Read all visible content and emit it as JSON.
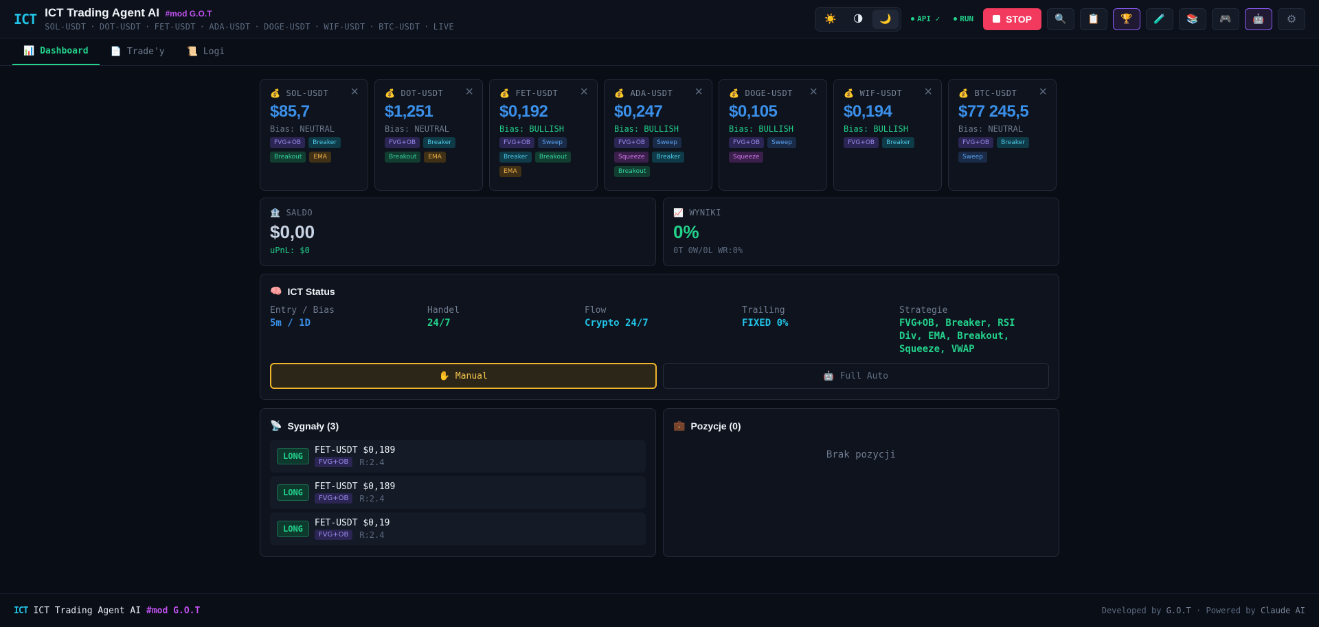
{
  "header": {
    "logo": "ICT",
    "title": "ICT Trading Agent AI",
    "mod": "#mod G.O.T",
    "pairs": [
      "SOL-USDT",
      "DOT-USDT",
      "FET-USDT",
      "ADA-USDT",
      "DOGE-USDT",
      "WIF-USDT",
      "BTC-USDT",
      "LIVE"
    ],
    "theme_icons": [
      "☀️",
      "🌗",
      "🌙"
    ],
    "api_label": "API ✓",
    "run_label": "RUN",
    "stop_label": "STOP",
    "tool_icons": [
      "🔍",
      "📋",
      "🏆",
      "🧪",
      "📚",
      "🎮",
      "🤖",
      "⚙"
    ]
  },
  "tabs": [
    {
      "icon": "📊",
      "label": "Dashboard"
    },
    {
      "icon": "📄",
      "label": "Trade'y"
    },
    {
      "icon": "📜",
      "label": "Logi"
    }
  ],
  "coins": [
    {
      "icon": "💰",
      "symbol": "SOL-USDT",
      "price": "$85,7",
      "bias": "Bias: NEUTRAL",
      "bias_type": "neutral",
      "tags": [
        {
          "label": "FVG+OB",
          "kind": "fvg"
        },
        {
          "label": "Breaker",
          "kind": "breaker"
        },
        {
          "label": "Breakout",
          "kind": "breakout"
        },
        {
          "label": "EMA",
          "kind": "ema"
        }
      ]
    },
    {
      "icon": "💰",
      "symbol": "DOT-USDT",
      "price": "$1,251",
      "bias": "Bias: NEUTRAL",
      "bias_type": "neutral",
      "tags": [
        {
          "label": "FVG+OB",
          "kind": "fvg"
        },
        {
          "label": "Breaker",
          "kind": "breaker"
        },
        {
          "label": "Breakout",
          "kind": "breakout"
        },
        {
          "label": "EMA",
          "kind": "ema"
        }
      ]
    },
    {
      "icon": "💰",
      "symbol": "FET-USDT",
      "price": "$0,192",
      "bias": "Bias: BULLISH",
      "bias_type": "bullish",
      "tags": [
        {
          "label": "FVG+OB",
          "kind": "fvg"
        },
        {
          "label": "Sweep",
          "kind": "sweep"
        },
        {
          "label": "Breaker",
          "kind": "breaker"
        },
        {
          "label": "Breakout",
          "kind": "breakout"
        },
        {
          "label": "EMA",
          "kind": "ema"
        }
      ]
    },
    {
      "icon": "💰",
      "symbol": "ADA-USDT",
      "price": "$0,247",
      "bias": "Bias: BULLISH",
      "bias_type": "bullish",
      "tags": [
        {
          "label": "FVG+OB",
          "kind": "fvg"
        },
        {
          "label": "Sweep",
          "kind": "sweep"
        },
        {
          "label": "Squeeze",
          "kind": "squeeze"
        },
        {
          "label": "Breaker",
          "kind": "breaker"
        },
        {
          "label": "Breakout",
          "kind": "breakout"
        }
      ]
    },
    {
      "icon": "💰",
      "symbol": "DOGE-USDT",
      "price": "$0,105",
      "bias": "Bias: BULLISH",
      "bias_type": "bullish",
      "tags": [
        {
          "label": "FVG+OB",
          "kind": "fvg"
        },
        {
          "label": "Sweep",
          "kind": "sweep"
        },
        {
          "label": "Squeeze",
          "kind": "squeeze"
        }
      ]
    },
    {
      "icon": "💰",
      "symbol": "WIF-USDT",
      "price": "$0,194",
      "bias": "Bias: BULLISH",
      "bias_type": "bullish",
      "tags": [
        {
          "label": "FVG+OB",
          "kind": "fvg"
        },
        {
          "label": "Breaker",
          "kind": "breaker"
        }
      ]
    },
    {
      "icon": "💰",
      "symbol": "BTC-USDT",
      "price": "$77 245,5",
      "bias": "Bias: NEUTRAL",
      "bias_type": "neutral",
      "tags": [
        {
          "label": "FVG+OB",
          "kind": "fvg"
        },
        {
          "label": "Breaker",
          "kind": "breaker"
        },
        {
          "label": "Sweep",
          "kind": "sweep"
        }
      ]
    }
  ],
  "saldo": {
    "icon": "🏦",
    "label": "SALDO",
    "value": "$0,00",
    "upnl": "uPnL: $0"
  },
  "wyniki": {
    "icon": "📈",
    "label": "WYNIKI",
    "value": "0%",
    "sub": "0T 0W/0L WR:0%"
  },
  "ict_status": {
    "icon": "🧠",
    "title": "ICT Status",
    "columns": [
      {
        "label": "Entry / Bias",
        "value": "5m / 1D",
        "color": "#3b8fe8"
      },
      {
        "label": "Handel",
        "value": "24/7",
        "color": "#23d18b"
      },
      {
        "label": "Flow",
        "value": "Crypto 24/7",
        "color": "#22c3e6"
      },
      {
        "label": "Trailing",
        "value": "FIXED 0%",
        "color": "#22c3e6"
      },
      {
        "label": "Strategie",
        "value": "FVG+OB, Breaker, RSI Div, EMA, Breakout, Squeeze, VWAP",
        "color": "#23d18b"
      }
    ],
    "manual": {
      "icon": "✋",
      "label": "Manual"
    },
    "auto": {
      "icon": "🤖",
      "label": "Full Auto"
    }
  },
  "signals": {
    "icon": "📡",
    "title": "Sygnały (3)",
    "items": [
      {
        "side": "LONG",
        "text": "FET-USDT $0,189",
        "tag": "FVG+OB",
        "rr": "R:2.4"
      },
      {
        "side": "LONG",
        "text": "FET-USDT $0,189",
        "tag": "FVG+OB",
        "rr": "R:2.4"
      },
      {
        "side": "LONG",
        "text": "FET-USDT $0,19",
        "tag": "FVG+OB",
        "rr": "R:2.4"
      }
    ]
  },
  "positions": {
    "icon": "💼",
    "title": "Pozycje (0)",
    "empty": "Brak pozycji"
  },
  "footer": {
    "logo": "ICT",
    "title": "ICT Trading Agent AI",
    "mod": "#mod G.O.T",
    "dev_prefix": "Developed by",
    "dev_name": "G.O.T",
    "sep": "·",
    "powered_prefix": "Powered by",
    "powered_name": "Claude AI"
  },
  "colors": {
    "accent": "#23d18b",
    "price": "#3b8fe8",
    "stop": "#f23a5e",
    "mod": "#c152f0"
  }
}
